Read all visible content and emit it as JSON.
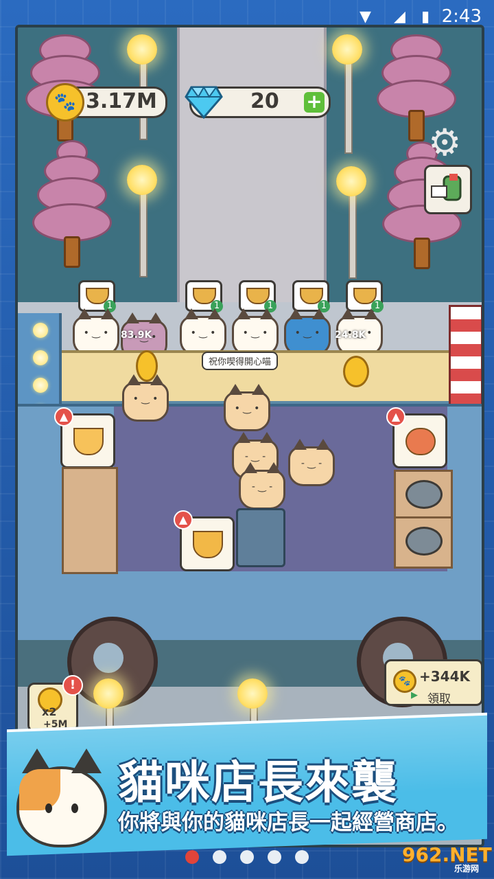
{
  "status_bar": {
    "time": "2:43"
  },
  "resources": {
    "coins": "3.17M",
    "gems": "20"
  },
  "speech_bubble": "祝你喫得開心喵",
  "customer_orders": [
    {
      "count": "1"
    },
    {
      "count": "1"
    },
    {
      "count": "1"
    },
    {
      "count": "1"
    },
    {
      "count": "1"
    }
  ],
  "customer_money": [
    "83.9K",
    "24.8K"
  ],
  "offers": {
    "collect_amount": "+344K",
    "collect_label": "領取",
    "double_label": "x2",
    "double_reward": "+5M",
    "alert": "!"
  },
  "banner": {
    "title": "貓咪店長來襲",
    "subtitle": "你將與你的貓咪店長一起經營商店。"
  },
  "pager": {
    "count": 5,
    "active": 0
  },
  "watermark": {
    "logo": "962.NET",
    "caption": "乐游网"
  },
  "colors": {
    "banner": "#4bbde8",
    "accent_red": "#e0443a",
    "coin": "#f6c12b"
  }
}
